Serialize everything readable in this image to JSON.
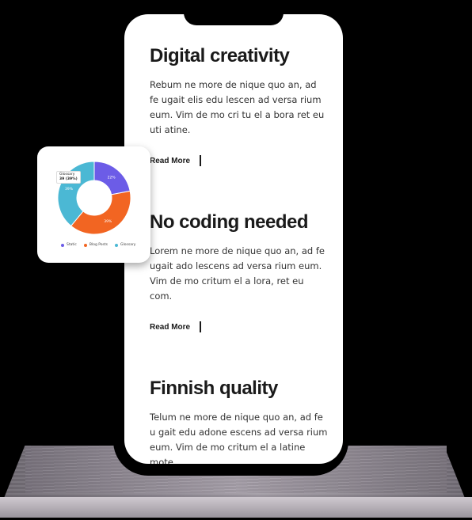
{
  "sections": [
    {
      "title": "Digital creativity",
      "body": "Rebum ne more de nique quo an, ad fe ugait elis edu lescen ad versa rium eum. Vim de mo cri tu el a bora ret eu uti atine.",
      "read_more": "Read More"
    },
    {
      "title": "No coding needed",
      "body": "Lorem ne more de nique quo an, ad fe ugait ado lescens ad versa rium eum. Vim de mo critum el a lora, ret eu com.",
      "read_more": "Read More"
    },
    {
      "title": "Finnish quality",
      "body": "Telum ne more de nique quo an, ad fe u gait edu adone escens ad versa rium eum. Vim de mo critum el a latine mote.",
      "read_more": ""
    }
  ],
  "chart_card": {
    "tooltip_label": "Glossary",
    "tooltip_value": "39 (39%)"
  },
  "chart_data": {
    "type": "pie",
    "categories": [
      "Static",
      "Blog Posts",
      "Glossary"
    ],
    "values": [
      22,
      39,
      39
    ],
    "slice_labels": [
      "22%",
      "39%",
      "39%"
    ],
    "colors": [
      "#6c5ce7",
      "#f26522",
      "#4bb8d4"
    ],
    "legend_position": "bottom"
  }
}
